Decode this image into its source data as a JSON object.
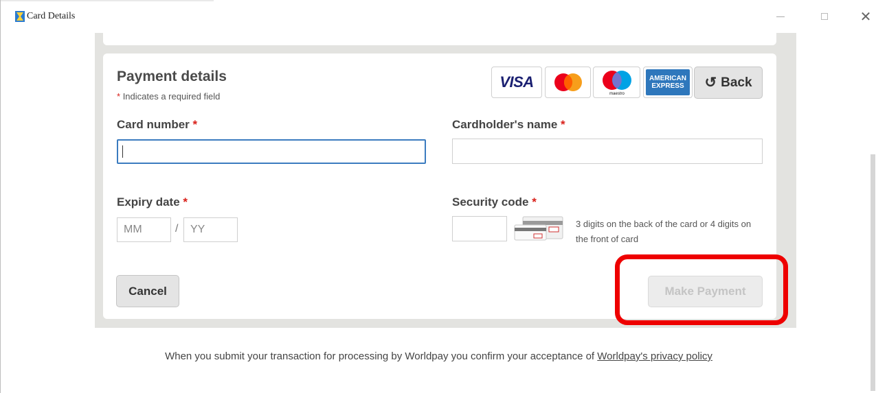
{
  "window": {
    "title": "Card Details",
    "minimize_icon": "minimize-icon",
    "maximize_icon": "maximize-icon",
    "close_icon": "close-icon",
    "close_glyph": "✕"
  },
  "payment": {
    "title": "Payment details",
    "required_star": "*",
    "required_note": "Indicates a required field",
    "back_label": "Back",
    "cards": {
      "visa": "VISA",
      "mastercard": "mastercard-logo",
      "maestro_text": "maestro",
      "amex_line1": "AMERICAN",
      "amex_line2": "EXPRESS"
    },
    "fields": {
      "card_number": {
        "label": "Card number",
        "value": "",
        "placeholder": ""
      },
      "cardholder": {
        "label": "Cardholder's name",
        "value": "",
        "placeholder": ""
      },
      "expiry": {
        "label": "Expiry date",
        "month_placeholder": "MM",
        "separator": "/",
        "year_placeholder": "YY"
      },
      "security": {
        "label": "Security code",
        "value": "",
        "hint": "3 digits on the back of the card or 4 digits on the front of card"
      }
    },
    "cancel_label": "Cancel",
    "pay_label": "Make Payment"
  },
  "footer": {
    "text": "When you submit your transaction for processing by Worldpay you confirm your acceptance of ",
    "link": "Worldpay's privacy policy"
  },
  "colors": {
    "accent": "#3a7bbf",
    "required": "#d9201a",
    "highlight": "#ee0000",
    "panel": "#e3e3e0"
  }
}
